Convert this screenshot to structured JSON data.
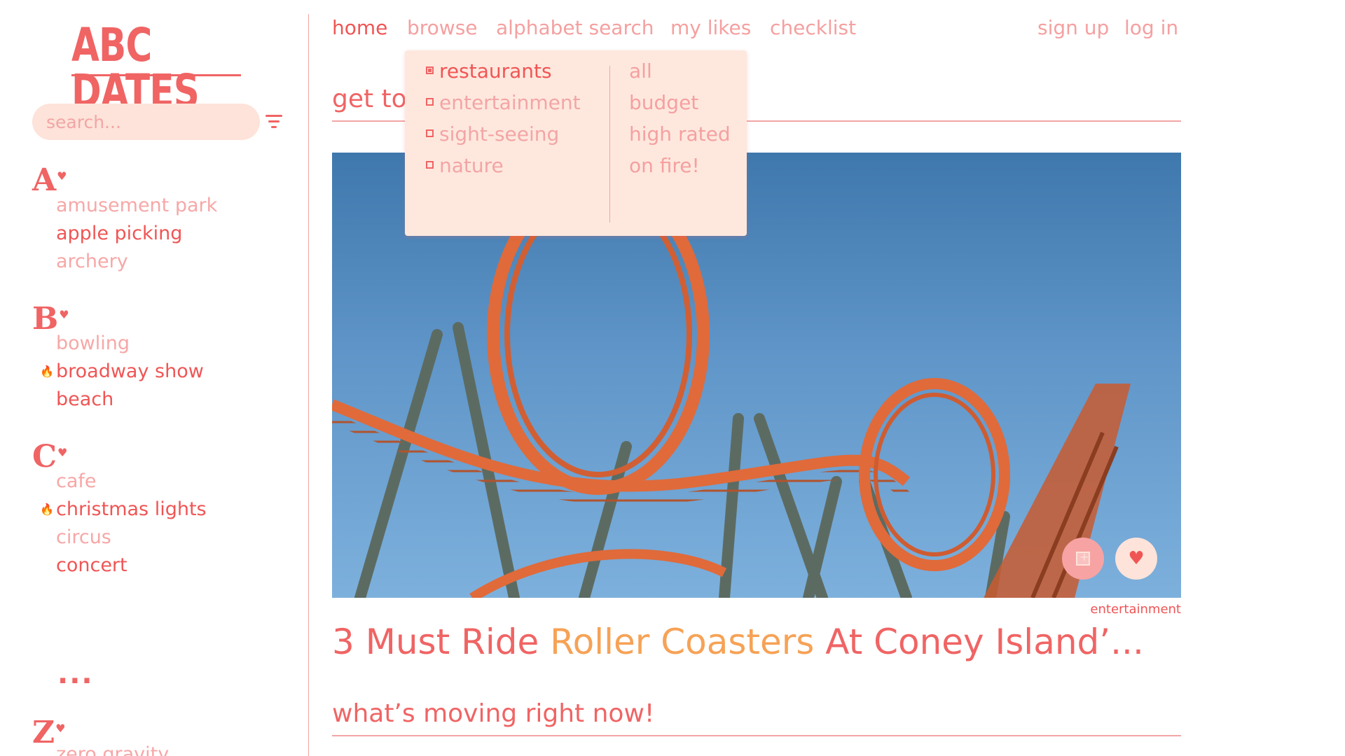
{
  "sidebar": {
    "logo": "ABC DATES",
    "search_placeholder": "search...",
    "groups": [
      {
        "letter": "A",
        "items": [
          {
            "label": "amusement park",
            "style": "light",
            "on_fire": false
          },
          {
            "label": "apple picking",
            "style": "dark",
            "on_fire": false
          },
          {
            "label": "archery",
            "style": "light",
            "on_fire": false
          }
        ]
      },
      {
        "letter": "B",
        "items": [
          {
            "label": "bowling",
            "style": "light",
            "on_fire": false
          },
          {
            "label": "broadway show",
            "style": "dark",
            "on_fire": true
          },
          {
            "label": "beach",
            "style": "dark",
            "on_fire": false
          }
        ]
      },
      {
        "letter": "C",
        "items": [
          {
            "label": "cafe",
            "style": "light",
            "on_fire": false
          },
          {
            "label": "christmas lights",
            "style": "dark",
            "on_fire": true
          },
          {
            "label": "circus",
            "style": "light",
            "on_fire": false
          },
          {
            "label": "concert",
            "style": "dark",
            "on_fire": false
          }
        ]
      },
      {
        "letter": "Z",
        "items": [
          {
            "label": "zero gravity",
            "style": "light",
            "on_fire": false
          }
        ]
      }
    ],
    "ellipsis": "..."
  },
  "nav": {
    "home": "home",
    "browse": "browse",
    "alphabet_search": "alphabet search",
    "my_likes": "my likes",
    "checklist": "checklist",
    "sign_up": "sign up",
    "log_in": "log in",
    "active": "home"
  },
  "dropdown": {
    "categories": [
      {
        "label": "restaurants",
        "checked": true
      },
      {
        "label": "entertainment",
        "checked": false
      },
      {
        "label": "sight-seeing",
        "checked": false
      },
      {
        "label": "nature",
        "checked": false
      }
    ],
    "options": [
      "all",
      "budget",
      "high rated",
      "on fire!"
    ]
  },
  "main": {
    "section1_title": "get to know",
    "article": {
      "tag": "entertainment",
      "title_part1": "3 Must Ride ",
      "title_highlight": "Roller Coasters",
      "title_part2": " At Coney Island’..."
    },
    "section2_title": "what’s moving right now!"
  },
  "colors": {
    "primary": "#f06464",
    "light": "#f7a7a7",
    "peach": "#fde3d9",
    "highlight": "#f6a256",
    "flame": "#f3873d"
  }
}
